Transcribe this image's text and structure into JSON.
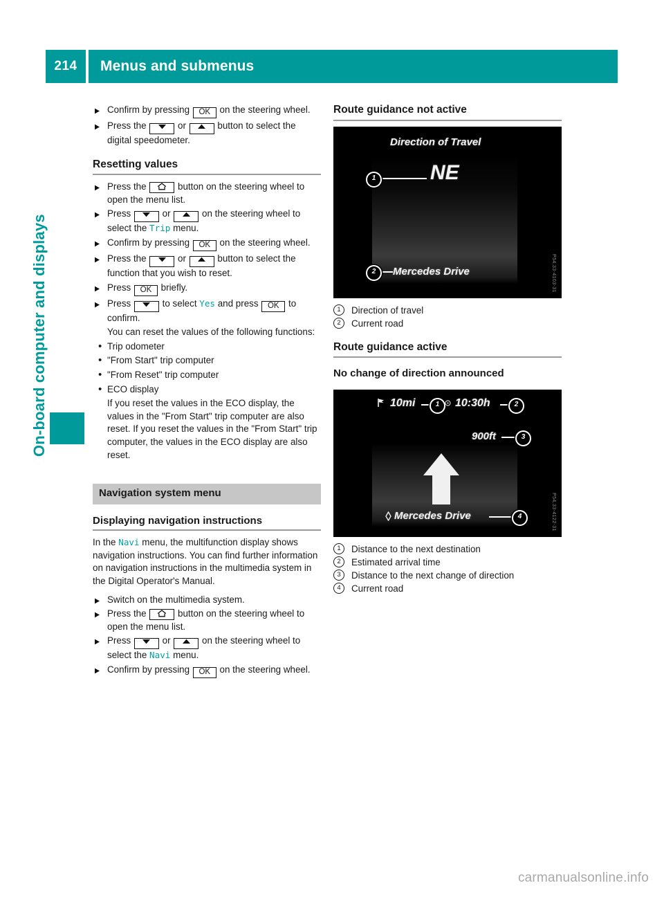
{
  "header": {
    "page_number": "214",
    "title": "Menus and submenus"
  },
  "side_tab": {
    "chapter": "On-board computer and displays"
  },
  "accent_color": "#009a9a",
  "left_column": {
    "steps_top": [
      {
        "parts": [
          "Confirm by pressing ",
          "[KEY:OK]",
          " on the steering wheel."
        ]
      },
      {
        "parts": [
          "Press the ",
          "[KEY:DOWN]",
          " or ",
          "[KEY:UP]",
          " button to select the digital speedometer."
        ]
      }
    ],
    "resetting_heading": "Resetting values",
    "steps_reset": [
      {
        "parts": [
          "Press the ",
          "[KEY:HOME]",
          " button on the steering wheel to open the menu list."
        ]
      },
      {
        "parts": [
          "Press ",
          "[KEY:DOWN]",
          " or ",
          "[KEY:UP]",
          " on the steering wheel to select the ",
          "[MENU:Trip]",
          " menu."
        ]
      },
      {
        "parts": [
          "Confirm by pressing ",
          "[KEY:OK]",
          " on the steering wheel."
        ]
      },
      {
        "parts": [
          "Press the ",
          "[KEY:DOWN]",
          " or ",
          "[KEY:UP]",
          " button to select the function that you wish to reset."
        ]
      },
      {
        "parts": [
          "Press ",
          "[KEY:OK]",
          " briefly."
        ]
      },
      {
        "parts": [
          "Press ",
          "[KEY:DOWN]",
          " to select ",
          "[MENU:Yes]",
          " and press ",
          "[KEY:OK]",
          " to confirm."
        ]
      }
    ],
    "reset_note": "You can reset the values of the following functions:",
    "reset_bullets": [
      "Trip odometer",
      "\"From Start\" trip computer",
      "\"From Reset\" trip computer",
      "ECO display"
    ],
    "reset_paragraph": "If you reset the values in the ECO display, the values in the \"From Start\" trip computer are also reset. If you reset the values in the \"From Start\" trip computer, the values in the ECO display are also reset.",
    "nav_bar_title": "Navigation system menu",
    "nav_sub_heading": "Displaying navigation instructions",
    "nav_paragraph": {
      "before": "In the ",
      "menu": "Navi",
      "after": " menu, the multifunction display shows navigation instructions. You can find further information on navigation instructions in the multimedia system in the Digital Operator's Manual."
    },
    "steps_nav": [
      {
        "parts": [
          "Switch on the multimedia system."
        ]
      },
      {
        "parts": [
          "Press the ",
          "[KEY:HOME]",
          " button on the steering wheel to open the menu list."
        ]
      },
      {
        "parts": [
          "Press ",
          "[KEY:DOWN]",
          " or ",
          "[KEY:UP]",
          " on the steering wheel to select the ",
          "[MENU:Navi]",
          " menu."
        ]
      },
      {
        "parts": [
          "Confirm by pressing ",
          "[KEY:OK]",
          " on the steering wheel."
        ]
      }
    ]
  },
  "right_column": {
    "heading_not_active": "Route guidance not active",
    "shot1": {
      "title": "Direction of Travel",
      "direction": "NE",
      "road": "Mercedes Drive",
      "callouts": [
        "1",
        "2"
      ],
      "code": "P54.33-4103-31"
    },
    "legend1": [
      {
        "num": "1",
        "text": "Direction of travel"
      },
      {
        "num": "2",
        "text": "Current road"
      }
    ],
    "heading_active": "Route guidance active",
    "sub_no_change": "No change of direction announced",
    "shot2": {
      "distance_to_destination": "10mi",
      "arrival_time": "10:30h",
      "distance_next_turn": "900ft",
      "road": "Mercedes Drive",
      "callouts": [
        "1",
        "2",
        "3",
        "4"
      ],
      "code": "P54.33-4122-31"
    },
    "legend2": [
      {
        "num": "1",
        "text": "Distance to the next destination"
      },
      {
        "num": "2",
        "text": "Estimated arrival time"
      },
      {
        "num": "3",
        "text": "Distance to the next change of direction"
      },
      {
        "num": "4",
        "text": "Current road"
      }
    ]
  },
  "watermark": "carmanualsonline.info"
}
